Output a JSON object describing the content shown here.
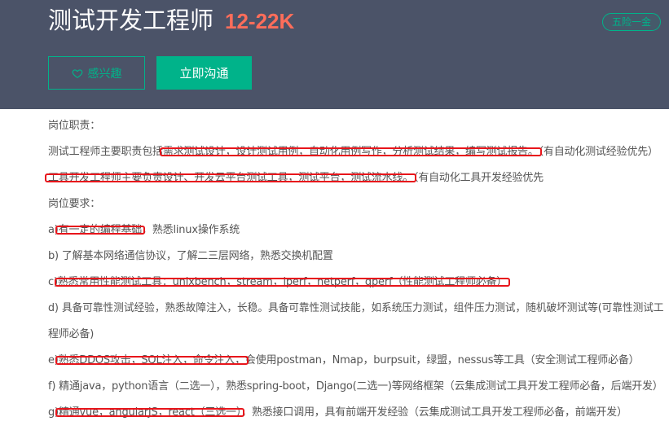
{
  "header": {
    "title": "测试开发工程师",
    "salary": "12-22K",
    "benefit": "五险一金",
    "interest_label": "感兴趣",
    "chat_label": "立即沟通",
    "accent_color": "#00b38a",
    "salary_color": "#fd6d5a",
    "header_bg": "#4b5368",
    "interest_icon": "heart-outline-icon"
  },
  "responsibilities": {
    "heading": "岗位职责：",
    "line1": {
      "prefix": "测试工程师主要职责包括",
      "highlight": "需求测试设计，设计测试用例，自动化用例写作，分析测试结果，编写测试报告。",
      "suffix": "（有自动化测试经验优先）"
    },
    "line2": {
      "highlight": "工具开发工程师主要负责设计、开发云平台测试工具，测试平台，测试流水线。",
      "suffix": "（有自动化工具开发经验优先"
    }
  },
  "requirements": {
    "heading": "岗位要求：",
    "a": {
      "prefix": "a)",
      "highlight": "有一定的编程基础",
      "suffix": "，熟悉linux操作系统"
    },
    "b": {
      "text": "b) 了解基本网络通信协议，了解二三层网络，熟悉交换机配置"
    },
    "c": {
      "prefix": "c)",
      "highlight": "熟悉常用性能测试工具：unixbench，stream，iperf，netperf，qperf（性能测试工程师必备）"
    },
    "d": {
      "text": "d) 具备可靠性测试经验，熟悉故障注入，长稳。具备可靠性测试技能，如系统压力测试，组件压力测试，随机破坏测试等(可靠性测试工",
      "continuation": "程师必备)"
    },
    "e": {
      "prefix": "e)",
      "highlight": "熟悉DDOS攻击，SQL注入，命令注入，",
      "suffix": "会使用postman，Nmap，burpsuit，绿盟，nessus等工具（安全测试工程师必备）"
    },
    "f": {
      "text": "f) 精通java，python语言（二选一），熟悉spring-boot，Django(二选一)等网络框架（云集成测试工具开发工程师必备，后端开发）"
    },
    "g": {
      "prefix": "g)",
      "highlight": "精通vue，angularJS，react（三选一）",
      "suffix": "，熟悉接口调用，具有前端开发经验（云集成测试工具开发工程师必备，前端开发）"
    }
  },
  "highlight_color": "#e8151b"
}
